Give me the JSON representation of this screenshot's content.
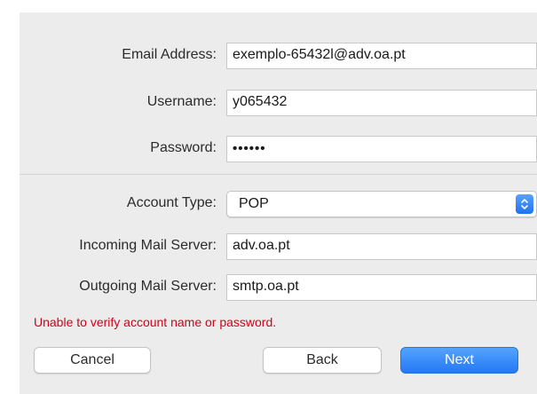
{
  "form": {
    "email": {
      "label": "Email Address:",
      "value": "exemplo-65432l@adv.oa.pt"
    },
    "username": {
      "label": "Username:",
      "value": "y065432"
    },
    "password": {
      "label": "Password:",
      "value": "••••••"
    },
    "account_type": {
      "label": "Account Type:",
      "value": "POP"
    },
    "incoming_server": {
      "label": "Incoming Mail Server:",
      "value": "adv.oa.pt"
    },
    "outgoing_server": {
      "label": "Outgoing Mail Server:",
      "value": "smtp.oa.pt"
    }
  },
  "error_message": "Unable to verify account name or password.",
  "buttons": {
    "cancel": "Cancel",
    "back": "Back",
    "next": "Next"
  },
  "colors": {
    "error": "#d0021b",
    "accent": "#2478f3"
  },
  "icons": {
    "select_stepper": "up-down-chevron-icon"
  }
}
